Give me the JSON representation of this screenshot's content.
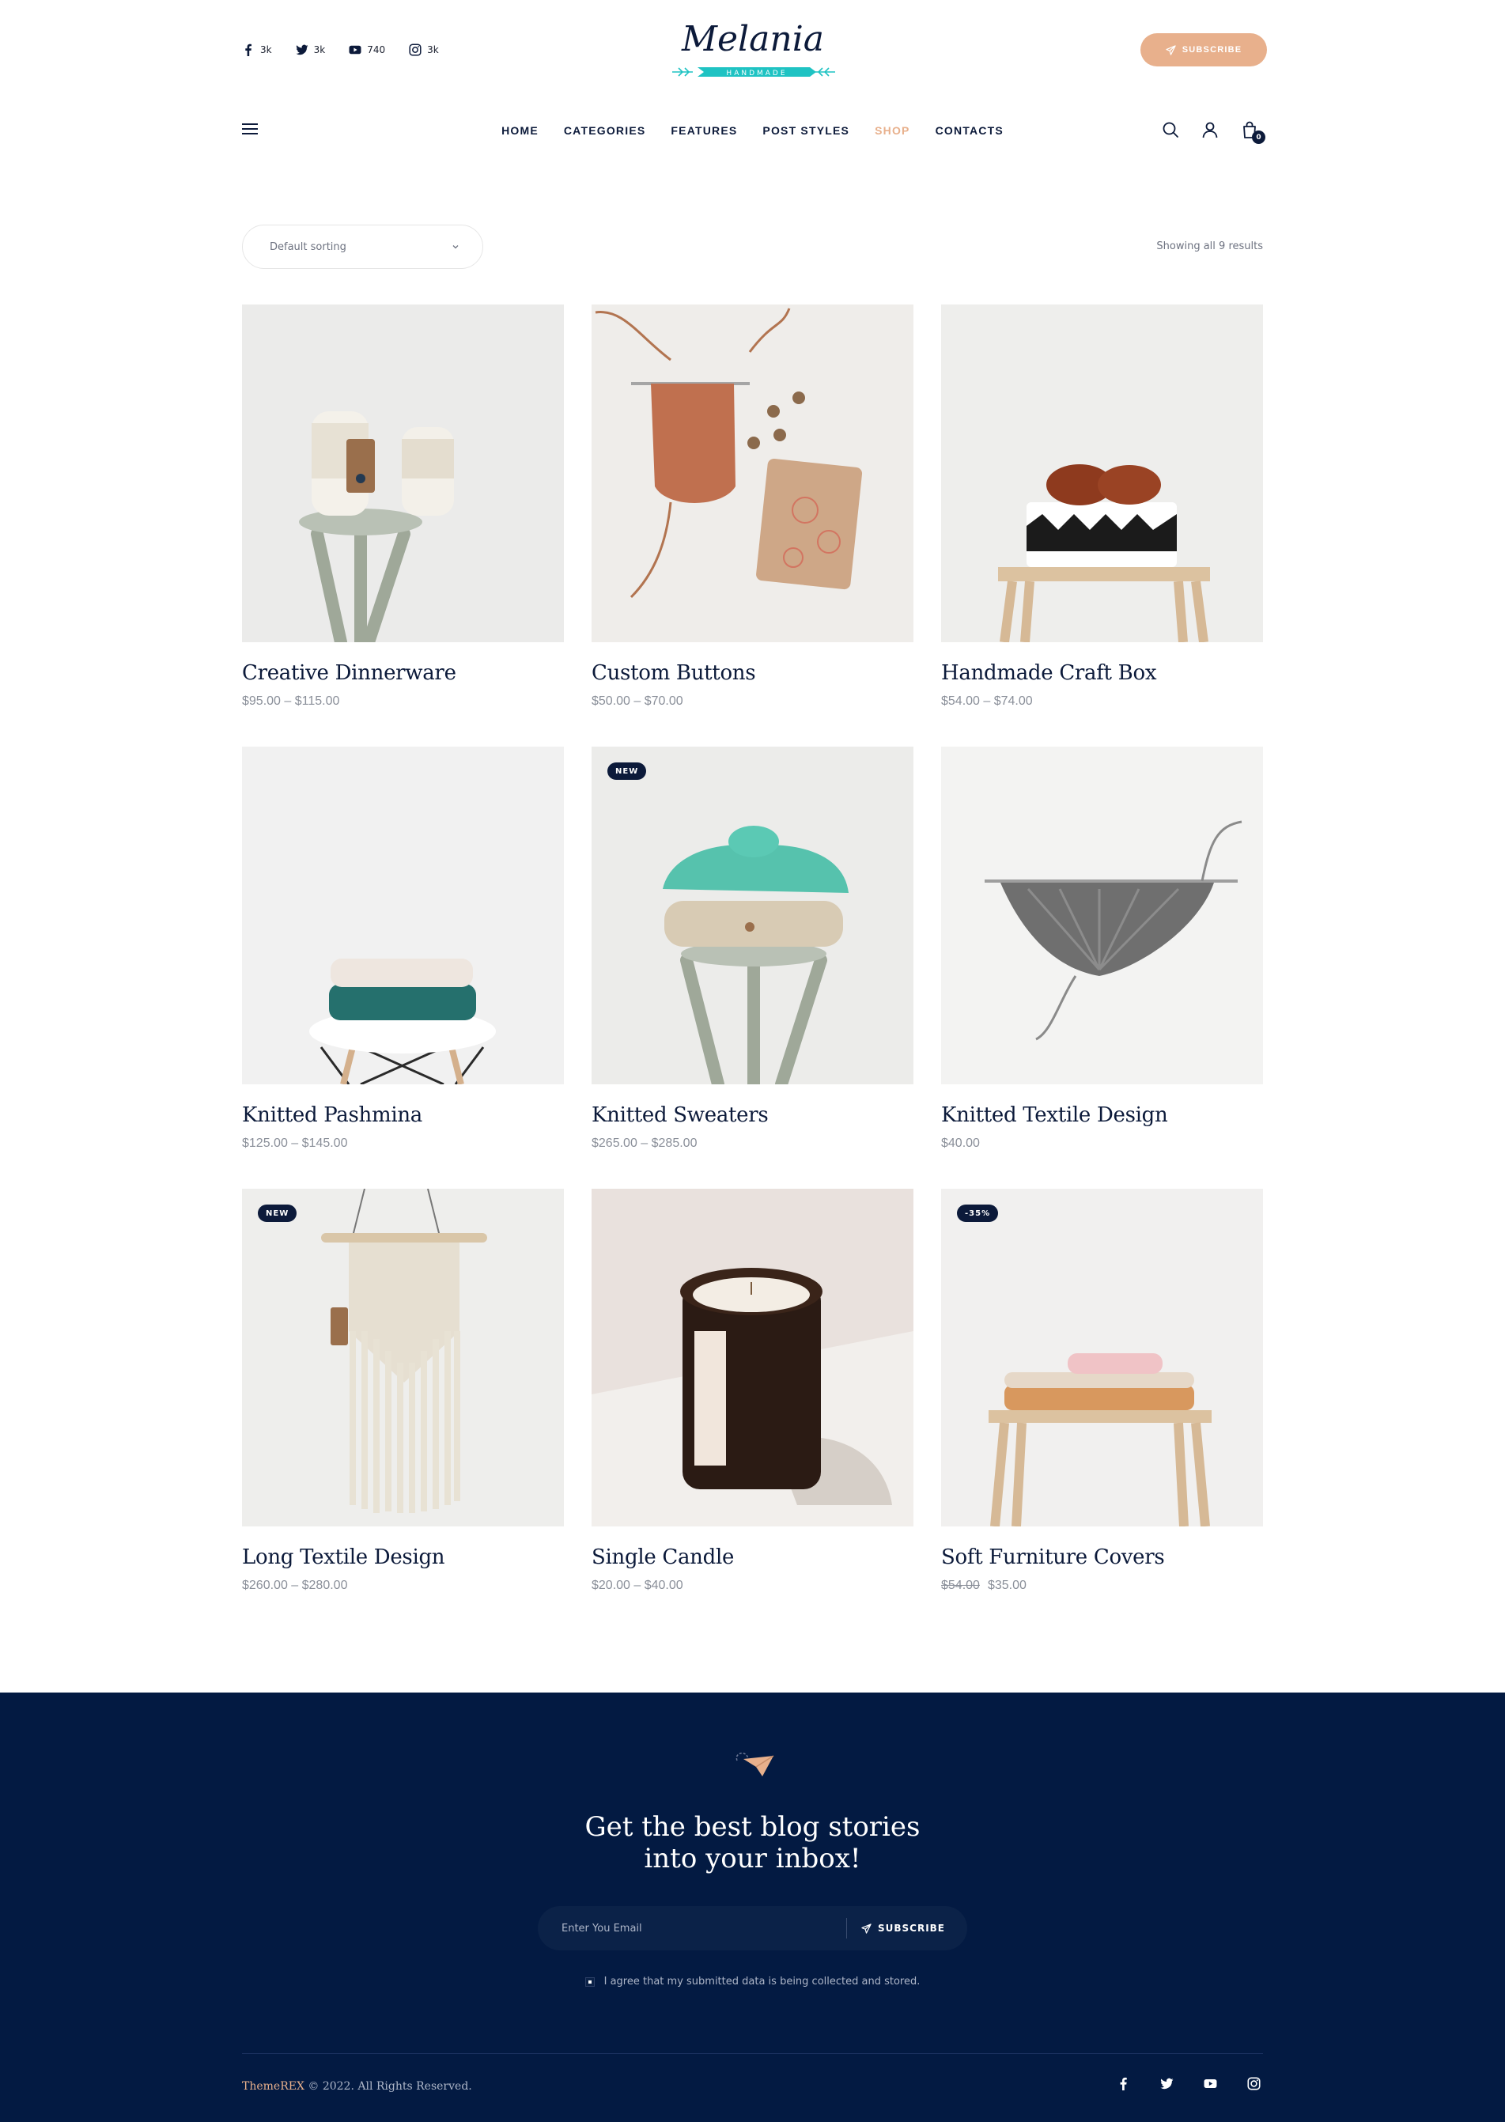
{
  "header": {
    "socials": [
      {
        "icon": "facebook-icon",
        "count": "3k"
      },
      {
        "icon": "twitter-icon",
        "count": "3k"
      },
      {
        "icon": "youtube-icon",
        "count": "740"
      },
      {
        "icon": "instagram-icon",
        "count": "3k"
      }
    ],
    "logo": {
      "script": "Melania",
      "tagline": "HANDMADE"
    },
    "subscribe_label": "SUBSCRIBE"
  },
  "nav": {
    "items": [
      {
        "label": "HOME"
      },
      {
        "label": "CATEGORIES"
      },
      {
        "label": "FEATURES"
      },
      {
        "label": "POST STYLES"
      },
      {
        "label": "SHOP",
        "active": true
      },
      {
        "label": "CONTACTS"
      }
    ],
    "cart_count": "0"
  },
  "shop": {
    "sorting": "Default sorting",
    "result_count": "Showing all 9 results",
    "products": [
      {
        "title": "Creative Dinnerware",
        "price": "$95.00 – $115.00"
      },
      {
        "title": "Custom Buttons",
        "price": "$50.00 – $70.00"
      },
      {
        "title": "Handmade Craft Box",
        "price": "$54.00 – $74.00"
      },
      {
        "title": "Knitted Pashmina",
        "price": "$125.00 – $145.00"
      },
      {
        "title": "Knitted Sweaters",
        "price": "$265.00 – $285.00",
        "badge": "NEW"
      },
      {
        "title": "Knitted Textile Design",
        "price": "$40.00"
      },
      {
        "title": "Long Textile Design",
        "price": "$260.00 – $280.00",
        "badge": "NEW"
      },
      {
        "title": "Single Candle",
        "price": "$20.00 – $40.00"
      },
      {
        "title": "Soft Furniture Covers",
        "old_price": "$54.00",
        "price": "$35.00",
        "badge": "-35%"
      }
    ]
  },
  "footer": {
    "heading_line1": "Get the best blog stories",
    "heading_line2": "into your inbox!",
    "email_placeholder": "Enter You Email",
    "subscribe_label": "SUBSCRIBE",
    "consent": "I agree that my submitted data is being collected and stored.",
    "brand": "ThemeREX",
    "copyright": " © 2022. All Rights Reserved.",
    "socials": [
      "facebook-icon",
      "twitter-icon",
      "youtube-icon",
      "instagram-icon"
    ]
  },
  "colors": {
    "accent": "#e8b08c",
    "navy": "#031a42",
    "logo_teal": "#1fc3c3"
  }
}
